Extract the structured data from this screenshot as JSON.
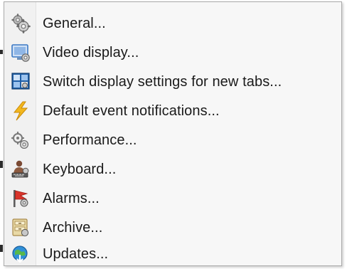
{
  "menu": {
    "items": [
      {
        "label": "General...",
        "icon": "gears-icon"
      },
      {
        "label": "Video display...",
        "icon": "video-display-icon"
      },
      {
        "label": "Switch display settings for new tabs...",
        "icon": "switch-display-icon"
      },
      {
        "label": "Default event notifications...",
        "icon": "lightning-icon"
      },
      {
        "label": "Performance...",
        "icon": "performance-gears-icon"
      },
      {
        "label": "Keyboard...",
        "icon": "keyboard-user-icon"
      },
      {
        "label": "Alarms...",
        "icon": "alarm-flag-icon"
      },
      {
        "label": "Archive...",
        "icon": "archive-icon"
      },
      {
        "label": "Updates...",
        "icon": "updates-icon"
      }
    ]
  },
  "colors": {
    "menu_background": "#f7f7f7",
    "menu_border": "#a9a9a9",
    "text": "#1a1a1a",
    "lightning": "#f2b71e",
    "alarm_flag": "#d9342b",
    "updates_globe": "#2f8fd8",
    "monitor_blue": "#3a78c4"
  }
}
